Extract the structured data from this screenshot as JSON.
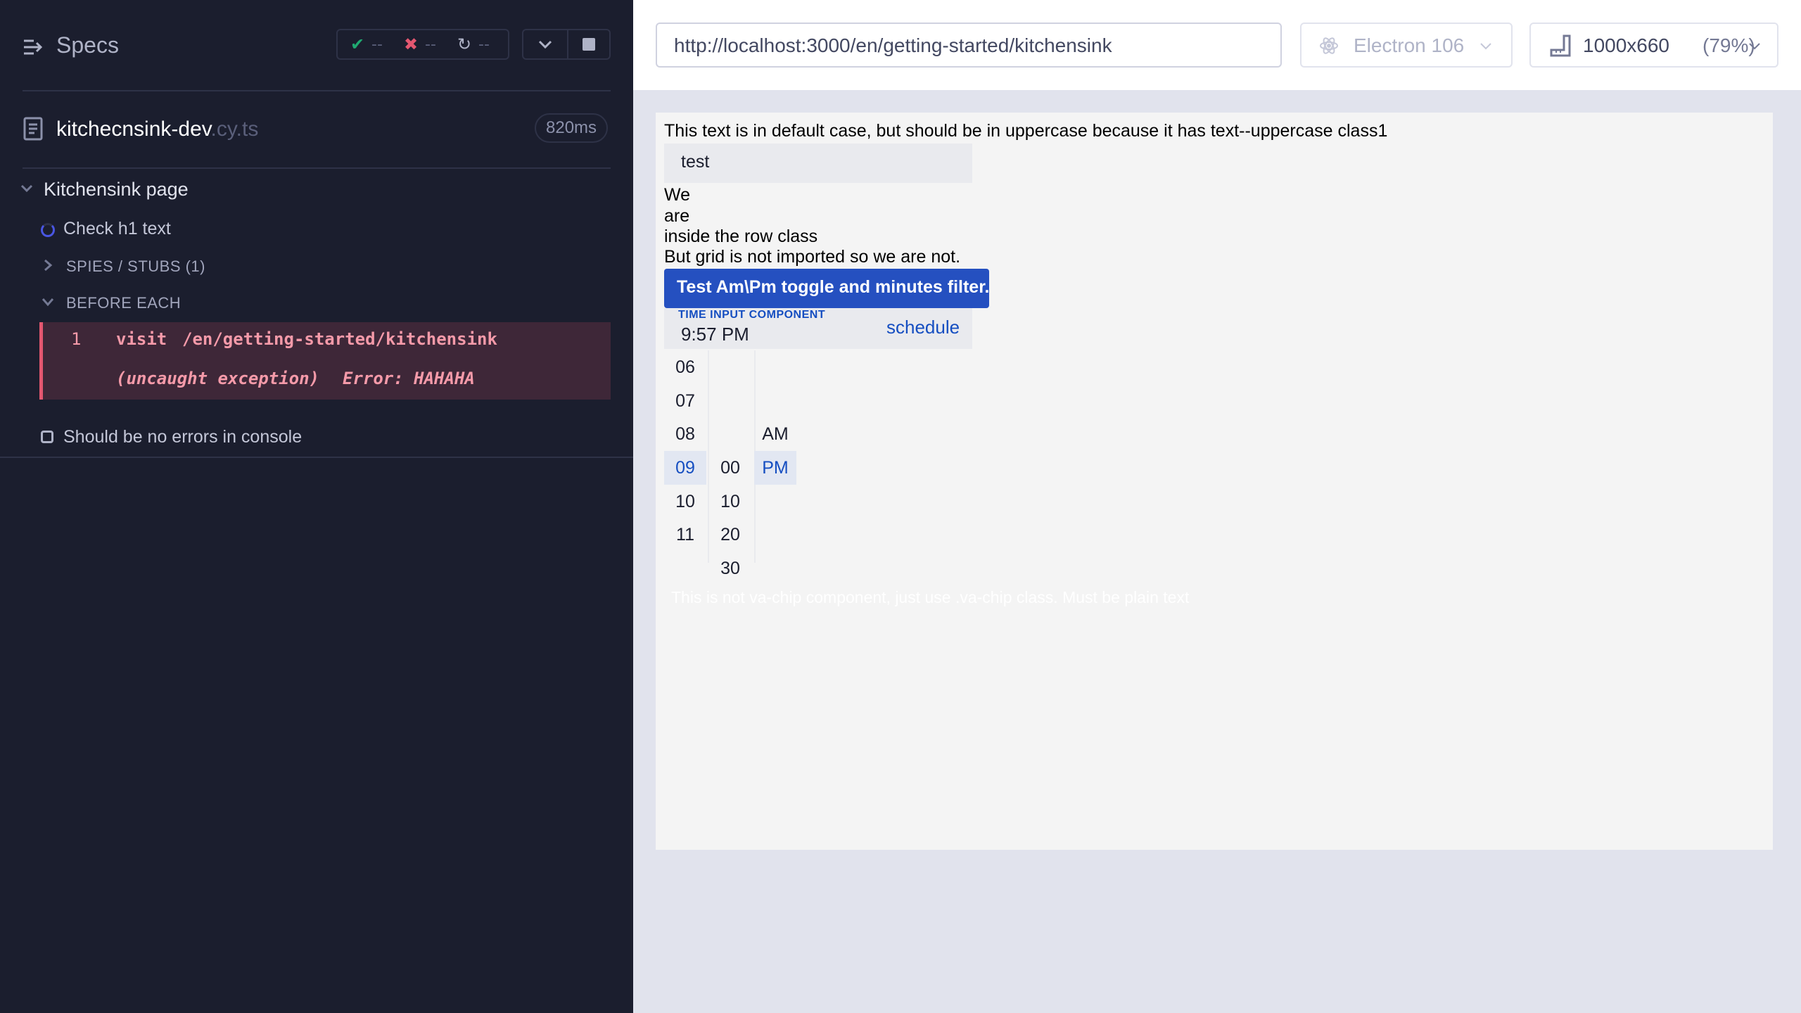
{
  "reporter": {
    "title": "Specs",
    "stats": {
      "passed": "--",
      "failed": "--",
      "pending": "--"
    },
    "spec": {
      "name": "kitchecnsink-dev",
      "ext": ".cy.ts",
      "duration": "820ms"
    },
    "suite": {
      "title": "Kitchensink page"
    },
    "tests": [
      {
        "title": "Check h1 text",
        "spies_label": "SPIES / STUBS (1)",
        "before_each_label": "BEFORE EACH",
        "command": {
          "number": "1",
          "name": "visit",
          "url": "/en/getting-started/kitchensink",
          "exception": "(uncaught exception)",
          "error": "Error: HAHAHA"
        }
      },
      {
        "title": "Should be no errors in console"
      }
    ]
  },
  "aut": {
    "url": "http://localhost:3000/en/getting-started/kitchensink",
    "browser": "Electron 106",
    "viewport": "1000x660",
    "scale": "(79%)"
  },
  "page": {
    "uppercase_text": "This text is in default case, but should be in uppercase because it has text--uppercase class1",
    "input_value": "test",
    "row_lines": [
      "We",
      "are",
      "inside the row class",
      "But grid is not imported so we are not."
    ],
    "toggle_button": "Test Am\\Pm toggle and minutes filter.",
    "time_input": {
      "label": "TIME INPUT COMPONENT",
      "value": "9:57 PM",
      "icon": "schedule"
    },
    "hours": [
      "06",
      "07",
      "08",
      "09",
      "10",
      "11"
    ],
    "selected_hour": "09",
    "minutes": [
      "00",
      "10",
      "20",
      "30"
    ],
    "periods": [
      "AM",
      "PM"
    ],
    "selected_period": "PM",
    "chip_text": "This is not va-chip component, just use .va-chip class. Must be plain text"
  },
  "colors": {
    "reporter_bg": "#1b1e2e",
    "error_bg": "#3e2738",
    "error_accent": "#e45770",
    "primary": "#2550c0",
    "link": "#154ec1"
  }
}
